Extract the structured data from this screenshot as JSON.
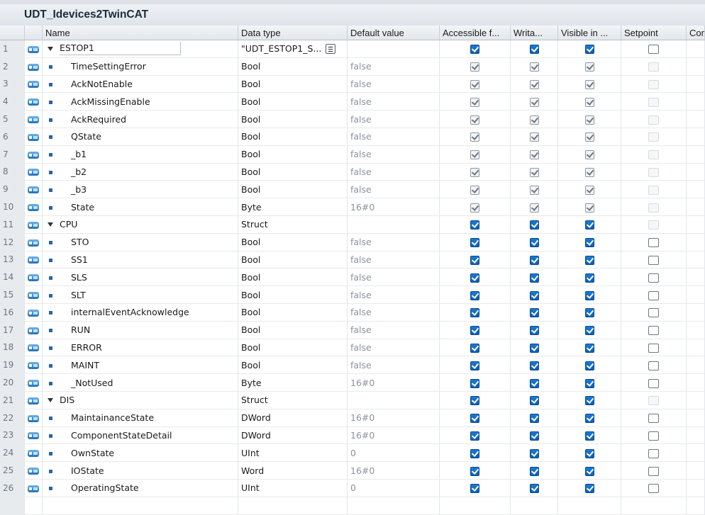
{
  "window": {
    "title": "UDT_Idevices2TwinCAT"
  },
  "columns": {
    "name": "Name",
    "data_type": "Data type",
    "default_value": "Default value",
    "accessible": "Accessible f...",
    "writable": "Writa...",
    "visible": "Visible in ...",
    "setpoint": "Setpoint",
    "comment": "Comment"
  },
  "rows": [
    {
      "num": "1",
      "name": "ESTOP1",
      "type": "\"UDT_ESTOP1_S...",
      "default": "",
      "level": 0,
      "expanded": true,
      "acc": "on",
      "wri": "on",
      "vis": "on",
      "set": "off"
    },
    {
      "num": "2",
      "name": "TimeSettingError",
      "type": "Bool",
      "default": "false",
      "level": 1,
      "acc": "grey",
      "wri": "grey",
      "vis": "grey",
      "set": "dis"
    },
    {
      "num": "3",
      "name": "AckNotEnable",
      "type": "Bool",
      "default": "false",
      "level": 1,
      "acc": "grey",
      "wri": "grey",
      "vis": "grey",
      "set": "dis"
    },
    {
      "num": "4",
      "name": "AckMissingEnable",
      "type": "Bool",
      "default": "false",
      "level": 1,
      "acc": "grey",
      "wri": "grey",
      "vis": "grey",
      "set": "dis"
    },
    {
      "num": "5",
      "name": "AckRequired",
      "type": "Bool",
      "default": "false",
      "level": 1,
      "acc": "grey",
      "wri": "grey",
      "vis": "grey",
      "set": "dis"
    },
    {
      "num": "6",
      "name": "QState",
      "type": "Bool",
      "default": "false",
      "level": 1,
      "acc": "grey",
      "wri": "grey",
      "vis": "grey",
      "set": "dis"
    },
    {
      "num": "7",
      "name": "_b1",
      "type": "Bool",
      "default": "false",
      "level": 1,
      "acc": "grey",
      "wri": "grey",
      "vis": "grey",
      "set": "dis"
    },
    {
      "num": "8",
      "name": "_b2",
      "type": "Bool",
      "default": "false",
      "level": 1,
      "acc": "grey",
      "wri": "grey",
      "vis": "grey",
      "set": "dis"
    },
    {
      "num": "9",
      "name": "_b3",
      "type": "Bool",
      "default": "false",
      "level": 1,
      "acc": "grey",
      "wri": "grey",
      "vis": "grey",
      "set": "dis"
    },
    {
      "num": "10",
      "name": "State",
      "type": "Byte",
      "default": "16#0",
      "level": 1,
      "acc": "grey",
      "wri": "grey",
      "vis": "grey",
      "set": "dis"
    },
    {
      "num": "11",
      "name": "CPU",
      "type": "Struct",
      "default": "",
      "level": 0,
      "expanded": true,
      "acc": "on",
      "wri": "on",
      "vis": "on",
      "set": "dis"
    },
    {
      "num": "12",
      "name": "STO",
      "type": "Bool",
      "default": "false",
      "level": 1,
      "acc": "on",
      "wri": "on",
      "vis": "on",
      "set": "off"
    },
    {
      "num": "13",
      "name": "SS1",
      "type": "Bool",
      "default": "false",
      "level": 1,
      "acc": "on",
      "wri": "on",
      "vis": "on",
      "set": "off"
    },
    {
      "num": "14",
      "name": "SLS",
      "type": "Bool",
      "default": "false",
      "level": 1,
      "acc": "on",
      "wri": "on",
      "vis": "on",
      "set": "off"
    },
    {
      "num": "15",
      "name": "SLT",
      "type": "Bool",
      "default": "false",
      "level": 1,
      "acc": "on",
      "wri": "on",
      "vis": "on",
      "set": "off"
    },
    {
      "num": "16",
      "name": "internalEventAcknowledge",
      "type": "Bool",
      "default": "false",
      "level": 1,
      "acc": "on",
      "wri": "on",
      "vis": "on",
      "set": "off"
    },
    {
      "num": "17",
      "name": "RUN",
      "type": "Bool",
      "default": "false",
      "level": 1,
      "acc": "on",
      "wri": "on",
      "vis": "on",
      "set": "off"
    },
    {
      "num": "18",
      "name": "ERROR",
      "type": "Bool",
      "default": "false",
      "level": 1,
      "acc": "on",
      "wri": "on",
      "vis": "on",
      "set": "off"
    },
    {
      "num": "19",
      "name": "MAINT",
      "type": "Bool",
      "default": "false",
      "level": 1,
      "acc": "on",
      "wri": "on",
      "vis": "on",
      "set": "off"
    },
    {
      "num": "20",
      "name": "_NotUsed",
      "type": "Byte",
      "default": "16#0",
      "level": 1,
      "acc": "on",
      "wri": "on",
      "vis": "on",
      "set": "off"
    },
    {
      "num": "21",
      "name": "DIS",
      "type": "Struct",
      "default": "",
      "level": 0,
      "expanded": true,
      "acc": "on",
      "wri": "on",
      "vis": "on",
      "set": "dis"
    },
    {
      "num": "22",
      "name": "MaintainanceState",
      "type": "DWord",
      "default": "16#0",
      "level": 1,
      "acc": "on",
      "wri": "on",
      "vis": "on",
      "set": "off"
    },
    {
      "num": "23",
      "name": "ComponentStateDetail",
      "type": "DWord",
      "default": "16#0",
      "level": 1,
      "acc": "on",
      "wri": "on",
      "vis": "on",
      "set": "off"
    },
    {
      "num": "24",
      "name": "OwnState",
      "type": "UInt",
      "default": "0",
      "level": 1,
      "acc": "on",
      "wri": "on",
      "vis": "on",
      "set": "off"
    },
    {
      "num": "25",
      "name": "IOState",
      "type": "Word",
      "default": "16#0",
      "level": 1,
      "acc": "on",
      "wri": "on",
      "vis": "on",
      "set": "off"
    },
    {
      "num": "26",
      "name": "OperatingState",
      "type": "UInt",
      "default": "0",
      "level": 1,
      "acc": "on",
      "wri": "on",
      "vis": "on",
      "set": "off"
    }
  ],
  "icons": {
    "row_interface": "interface-variable-icon",
    "expand": "expand-triangle-icon",
    "member": "member-square-icon",
    "type_browse": "type-browse-icon"
  },
  "colors": {
    "checkbox_active": "#0d5fb5",
    "checkbox_inherited": "#8e979f",
    "header_bg": "#e3e7eb"
  }
}
